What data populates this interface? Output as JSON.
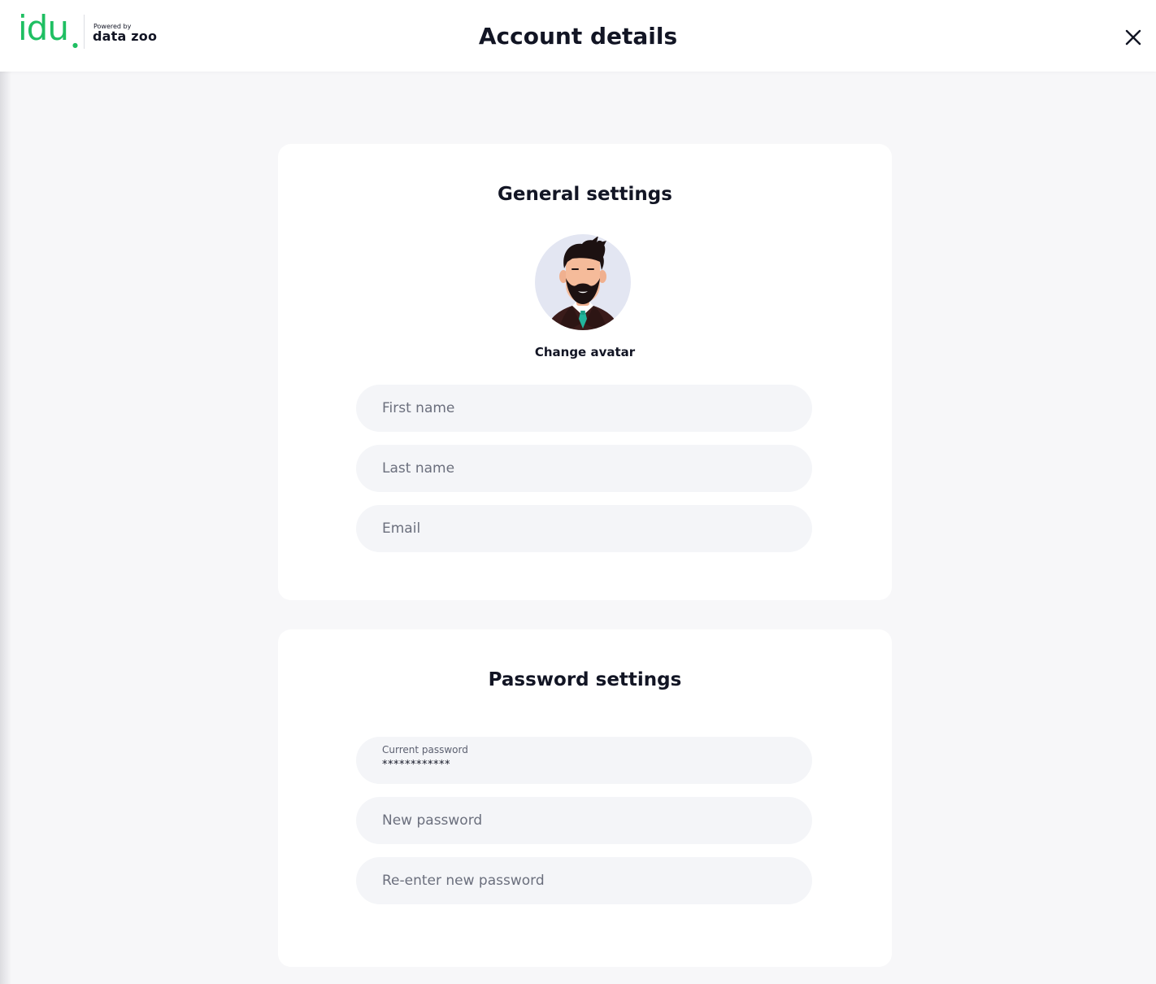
{
  "header": {
    "logo": {
      "brand": "idu",
      "powered_by": "Powered by",
      "partner": "data zoo"
    },
    "title": "Account details",
    "close_icon": "close-icon"
  },
  "general_settings": {
    "title": "General settings",
    "avatar_icon": "avatar-man-beard-icon",
    "change_avatar_label": "Change avatar",
    "fields": {
      "first_name": {
        "placeholder": "First name",
        "value": ""
      },
      "last_name": {
        "placeholder": "Last name",
        "value": ""
      },
      "email": {
        "placeholder": "Email",
        "value": ""
      }
    }
  },
  "password_settings": {
    "title": "Password settings",
    "current_password": {
      "label": "Current password",
      "value": "************"
    },
    "new_password": {
      "placeholder": "New password",
      "value": ""
    },
    "reenter_password": {
      "placeholder": "Re-enter new password",
      "value": ""
    }
  },
  "colors": {
    "brand_green": "#1fbf62",
    "text_dark": "#121524",
    "background": "#f7f7f9",
    "field_background": "#f4f5f8"
  }
}
